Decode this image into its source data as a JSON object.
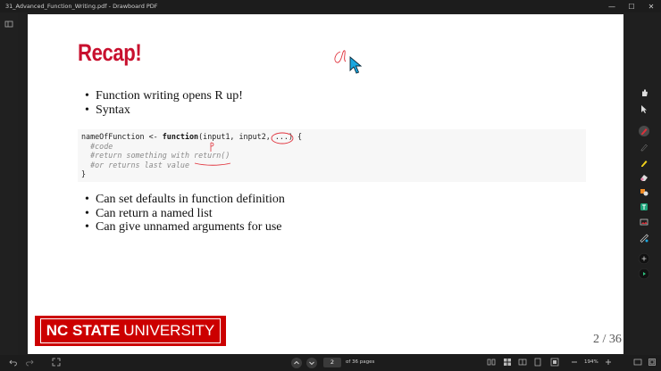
{
  "window": {
    "title": "31_Advanced_Function_Writing.pdf - Drawboard PDF",
    "minimize": "—",
    "maximize": "☐",
    "close": "✕"
  },
  "slide": {
    "title": "Recap!",
    "bullets_top": [
      "Function writing opens R up!",
      "Syntax"
    ],
    "code": {
      "line1_name": "nameOfFunction <- ",
      "line1_kw": "function",
      "line1_rest": "(input1, input2, ...) {",
      "line2": "  #code",
      "line3": "  #return something with return()",
      "line4": "  #or returns last value",
      "line5": "}"
    },
    "bullets_bottom": [
      "Can set defaults in function definition",
      "Can return a named list",
      "Can give unnamed arguments for use"
    ],
    "logo": {
      "bold": "NC STATE",
      "rest": "UNIVERSITY"
    },
    "page_number": "2 / 36"
  },
  "bottom": {
    "current_page": "2",
    "of_pages": "of 36 pages",
    "zoom": "194%"
  },
  "colors": {
    "brand_red": "#cc0000",
    "title_red": "#c8102e",
    "annotation_red": "#e0303a"
  }
}
